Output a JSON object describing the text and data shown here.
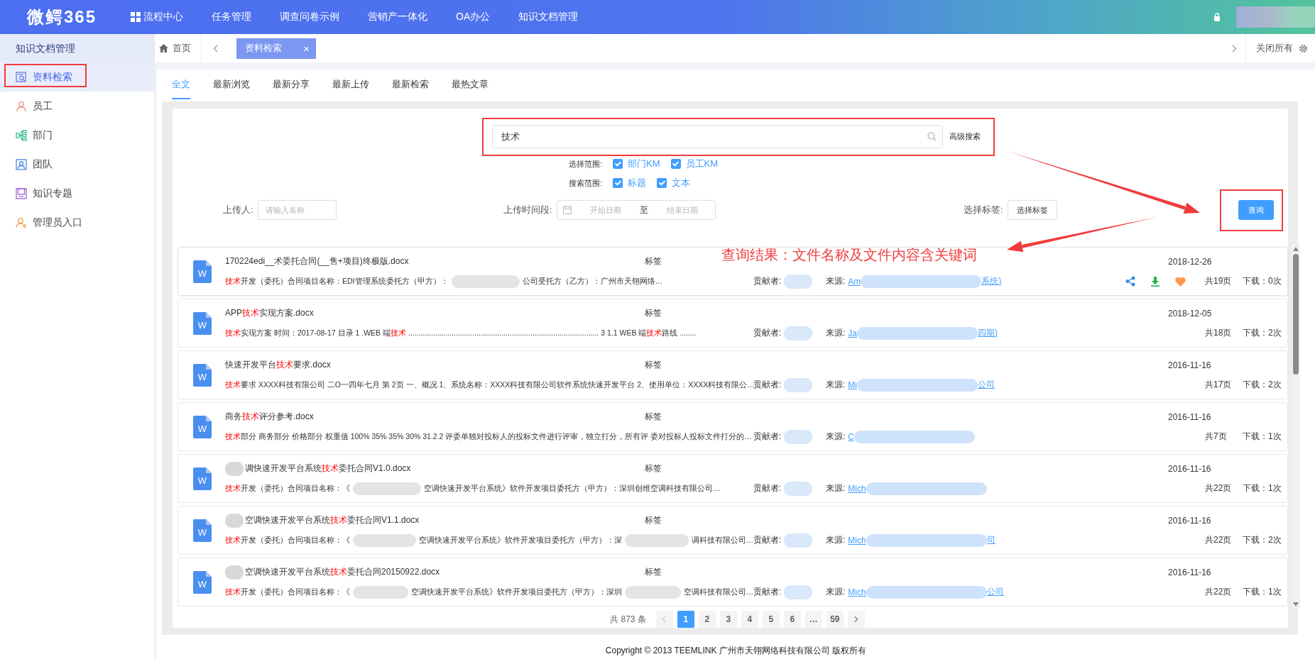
{
  "top_bar": {
    "logo": "微鳄365",
    "nav": [
      {
        "label": "流程中心"
      },
      {
        "label": "任务管理"
      },
      {
        "label": "调查问卷示例"
      },
      {
        "label": "营销产一体化"
      },
      {
        "label": "OA办公"
      },
      {
        "label": "知识文档管理"
      }
    ]
  },
  "sidebar": {
    "title": "知识文档管理",
    "items": [
      {
        "label": "资料检索",
        "selected": true
      },
      {
        "label": "员工",
        "selected": false
      },
      {
        "label": "部门",
        "selected": false
      },
      {
        "label": "团队",
        "selected": false
      },
      {
        "label": "知识专题",
        "selected": false
      },
      {
        "label": "管理员入口",
        "selected": false
      }
    ]
  },
  "tab_bar": {
    "home": "首页",
    "tabs": [
      {
        "label": "资料检索",
        "selected": true,
        "close": "×"
      }
    ],
    "close_all": "关闭所有"
  },
  "sub_tabs": [
    {
      "label": "全文",
      "selected": true
    },
    {
      "label": "最新浏览",
      "selected": false
    },
    {
      "label": "最新分享",
      "selected": false
    },
    {
      "label": "最新上传",
      "selected": false
    },
    {
      "label": "最新检索",
      "selected": false
    },
    {
      "label": "最热文章",
      "selected": false
    }
  ],
  "search": {
    "value": "技术",
    "advanced": "高级搜索"
  },
  "scopes": [
    {
      "label": "选择范围:",
      "options": [
        {
          "label": "部门KM",
          "checked": true
        },
        {
          "label": "员工KM",
          "checked": true
        }
      ]
    },
    {
      "label": "搜索范围:",
      "options": [
        {
          "label": "标题",
          "checked": true
        },
        {
          "label": "文本",
          "checked": true
        }
      ]
    }
  ],
  "filters": {
    "uploader": {
      "label": "上传人:",
      "placeholder": "请输入名称"
    },
    "period": {
      "label": "上传时间段:",
      "start_placeholder": "开始日期",
      "separator": "至",
      "end_placeholder": "结束日期"
    },
    "tags": {
      "label": "选择标签:",
      "button": "选择标签"
    },
    "query_button": "查询"
  },
  "annotation_note": "查询结果：文件名称及文件内容含关键词",
  "results": [
    {
      "icon_letter": "W",
      "title": [
        {
          "kind": "text",
          "text": "170224edi__术委托合同(__售+项目)终极版.docx",
          "hit": false
        }
      ],
      "tag": "标签",
      "date": "2018-12-26",
      "snippet": [
        {
          "kind": "text",
          "text": "技术",
          "hit": true
        },
        {
          "kind": "text",
          "text": "开发（委托）合同项目名称：EDI管理系统委托方（甲方）：",
          "hit": false
        },
        {
          "kind": "blur"
        },
        {
          "kind": "text",
          "text": "公司受托方（乙方）：广州市天翎网络…",
          "hit": false
        }
      ],
      "contributor_label": "贡献者:",
      "source_label": "来源:",
      "source": [
        {
          "kind": "text",
          "text": "Am",
          "hit": false
        },
        {
          "kind": "blur"
        },
        {
          "kind": "text",
          "text": "系统)",
          "hit": false
        }
      ],
      "hovered": true,
      "pages": "共19页",
      "downloads": "下载：0次"
    },
    {
      "icon_letter": "W",
      "title": [
        {
          "kind": "text",
          "text": "APP",
          "hit": false
        },
        {
          "kind": "text",
          "text": "技术",
          "hit": true
        },
        {
          "kind": "text",
          "text": "实现方案.docx",
          "hit": false
        }
      ],
      "tag": "标签",
      "date": "2018-12-05",
      "snippet": [
        {
          "kind": "text",
          "text": "技术",
          "hit": true
        },
        {
          "kind": "text",
          "text": "实现方案 时间：2017-08-17 目录 1 .WEB 端",
          "hit": false
        },
        {
          "kind": "text",
          "text": "技术",
          "hit": true
        },
        {
          "kind": "text",
          "text": " ............................................................................................ 3 1.1 WEB 端",
          "hit": false
        },
        {
          "kind": "text",
          "text": "技术",
          "hit": true
        },
        {
          "kind": "text",
          "text": "路线 ........",
          "hit": false
        }
      ],
      "contributor_label": "贡献者:",
      "source_label": "来源:",
      "source": [
        {
          "kind": "text",
          "text": "Ja",
          "hit": false
        },
        {
          "kind": "blur"
        },
        {
          "kind": "text",
          "text": "四期)",
          "hit": false
        }
      ],
      "hovered": false,
      "pages": "共18页",
      "downloads": "下载：2次"
    },
    {
      "icon_letter": "W",
      "title": [
        {
          "kind": "text",
          "text": "快速开发平台",
          "hit": false
        },
        {
          "kind": "text",
          "text": "技术",
          "hit": true
        },
        {
          "kind": "text",
          "text": "要求.docx",
          "hit": false
        }
      ],
      "tag": "标签",
      "date": "2016-11-16",
      "snippet": [
        {
          "kind": "text",
          "text": "技术",
          "hit": true
        },
        {
          "kind": "text",
          "text": "要求 XXXX科技有限公司 二O一四年七月 第 2页 一、概况 1、系统名称：XXXX科技有限公司软件系统快速开发平台 2、使用单位：XXXX科技有限公…",
          "hit": false
        }
      ],
      "contributor_label": "贡献者:",
      "source_label": "来源:",
      "source": [
        {
          "kind": "text",
          "text": "Mi",
          "hit": false
        },
        {
          "kind": "blur"
        },
        {
          "kind": "text",
          "text": "公司",
          "hit": false
        }
      ],
      "hovered": false,
      "pages": "共17页",
      "downloads": "下载：2次"
    },
    {
      "icon_letter": "W",
      "title": [
        {
          "kind": "text",
          "text": "商务",
          "hit": false
        },
        {
          "kind": "text",
          "text": "技术",
          "hit": true
        },
        {
          "kind": "text",
          "text": "评分参考.docx",
          "hit": false
        }
      ],
      "tag": "标签",
      "date": "2016-11-16",
      "snippet": [
        {
          "kind": "text",
          "text": "技术",
          "hit": true
        },
        {
          "kind": "text",
          "text": "部分 商务部分 价格部分 权重值 100% 35% 35% 30% 31.2.2 评委单独对投标人的投标文件进行评审，独立打分，所有评 委对投标人投标文件打分的…",
          "hit": false
        }
      ],
      "contributor_label": "贡献者:",
      "source_label": "来源:",
      "source": [
        {
          "kind": "text",
          "text": "C",
          "hit": false
        },
        {
          "kind": "blur"
        }
      ],
      "hovered": false,
      "pages": "共7页",
      "downloads": "下载：1次"
    },
    {
      "icon_letter": "W",
      "title": [
        {
          "kind": "blur"
        },
        {
          "kind": "text",
          "text": "调快速开发平台系统",
          "hit": false
        },
        {
          "kind": "text",
          "text": "技术",
          "hit": true
        },
        {
          "kind": "text",
          "text": "委托合同V1.0.docx",
          "hit": false
        }
      ],
      "tag": "标签",
      "date": "2016-11-16",
      "snippet": [
        {
          "kind": "text",
          "text": "技术",
          "hit": true
        },
        {
          "kind": "text",
          "text": "开发（委托）合同项目名称：《",
          "hit": false
        },
        {
          "kind": "blur"
        },
        {
          "kind": "text",
          "text": "空调快速开发平台系统》软件开发项目委托方（甲方）：深圳创维空调科技有限公司…",
          "hit": false
        }
      ],
      "contributor_label": "贡献者:",
      "source_label": "来源:",
      "source": [
        {
          "kind": "text",
          "text": "Mich",
          "hit": false
        },
        {
          "kind": "blur"
        }
      ],
      "hovered": false,
      "pages": "共22页",
      "downloads": "下载：1次"
    },
    {
      "icon_letter": "W",
      "title": [
        {
          "kind": "blur"
        },
        {
          "kind": "text",
          "text": "空调快速开发平台系统",
          "hit": false
        },
        {
          "kind": "text",
          "text": "技术",
          "hit": true
        },
        {
          "kind": "text",
          "text": "委托合同V1.1.docx",
          "hit": false
        }
      ],
      "tag": "标签",
      "date": "2016-11-16",
      "snippet": [
        {
          "kind": "text",
          "text": "技术",
          "hit": true
        },
        {
          "kind": "text",
          "text": "开发（委托）合同项目名称：《",
          "hit": false
        },
        {
          "kind": "blur"
        },
        {
          "kind": "text",
          "text": "空调快速开发平台系统》软件开发项目委托方（甲方）：深",
          "hit": false
        },
        {
          "kind": "blur"
        },
        {
          "kind": "text",
          "text": "调科技有限公司…",
          "hit": false
        }
      ],
      "contributor_label": "贡献者:",
      "source_label": "来源:",
      "source": [
        {
          "kind": "text",
          "text": "Mich",
          "hit": false
        },
        {
          "kind": "blur"
        },
        {
          "kind": "text",
          "text": "司",
          "hit": false
        }
      ],
      "hovered": false,
      "pages": "共22页",
      "downloads": "下载：2次"
    },
    {
      "icon_letter": "W",
      "title": [
        {
          "kind": "blur"
        },
        {
          "kind": "text",
          "text": "空调快速开发平台系统",
          "hit": false
        },
        {
          "kind": "text",
          "text": "技术",
          "hit": true
        },
        {
          "kind": "text",
          "text": "委托合同20150922.docx",
          "hit": false
        }
      ],
      "tag": "标签",
      "date": "2016-11-16",
      "snippet": [
        {
          "kind": "text",
          "text": "技术",
          "hit": true
        },
        {
          "kind": "text",
          "text": "开发（委托）合同项目名称：《",
          "hit": false
        },
        {
          "kind": "blur"
        },
        {
          "kind": "text",
          "text": "空调快速开发平台系统》软件开发项目委托方（甲方）：深圳",
          "hit": false
        },
        {
          "kind": "blur"
        },
        {
          "kind": "text",
          "text": "空调科技有限公司…",
          "hit": false
        }
      ],
      "contributor_label": "贡献者:",
      "source_label": "来源:",
      "source": [
        {
          "kind": "text",
          "text": "Mich",
          "hit": false
        },
        {
          "kind": "blur"
        },
        {
          "kind": "text",
          "text": "公司",
          "hit": false
        }
      ],
      "hovered": false,
      "pages": "共22页",
      "downloads": "下载：1次"
    }
  ],
  "pagination": {
    "total": "共 873 条",
    "pages": [
      {
        "label": "1",
        "selected": true
      },
      {
        "label": "2",
        "selected": false
      },
      {
        "label": "3",
        "selected": false
      },
      {
        "label": "4",
        "selected": false
      },
      {
        "label": "5",
        "selected": false
      },
      {
        "label": "6",
        "selected": false
      },
      {
        "label": "…",
        "selected": false
      },
      {
        "label": "59",
        "selected": false
      }
    ]
  },
  "footer": "Copyright © 2013 TEEMLINK 广州市天翎网络科技有限公司 版权所有"
}
